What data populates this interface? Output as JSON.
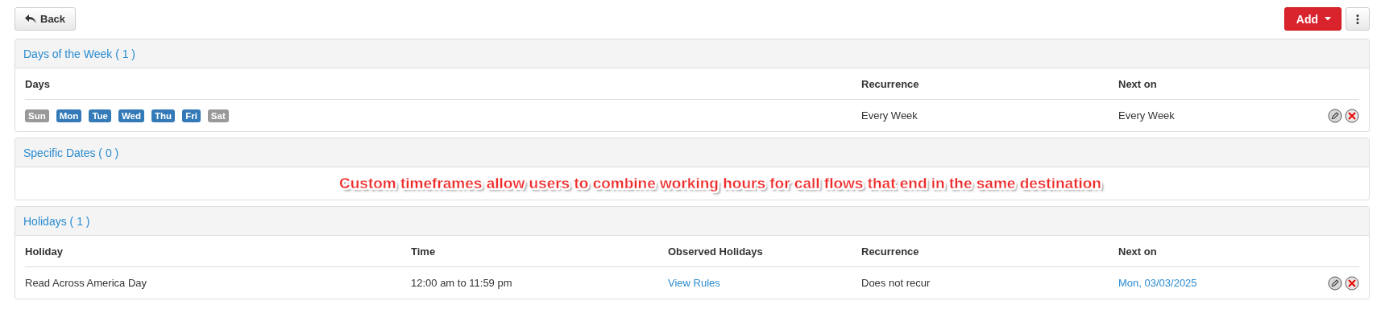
{
  "toolbar": {
    "back_button": "Back",
    "add_button": "Add"
  },
  "sections": [
    {
      "kind": "days",
      "title": "Days of the Week ( 1 )",
      "columns": [
        "Days",
        "Recurrence",
        "Next on"
      ],
      "rows": [
        {
          "cells": [
            {
              "kind": "days",
              "days": [
                {
                  "label": "Sun",
                  "selected": false
                },
                {
                  "label": "Mon",
                  "selected": true
                },
                {
                  "label": "Tue",
                  "selected": true
                },
                {
                  "label": "Wed",
                  "selected": true
                },
                {
                  "label": "Thu",
                  "selected": true
                },
                {
                  "label": "Fri",
                  "selected": true
                },
                {
                  "label": "Sat",
                  "selected": false
                }
              ]
            },
            {
              "kind": "text",
              "text": "Every Week"
            },
            {
              "kind": "text",
              "text": "Every Week"
            }
          ]
        }
      ]
    },
    {
      "kind": "dates",
      "title": "Specific Dates ( 0 )"
    },
    {
      "kind": "holidays",
      "title": "Holidays ( 1 )",
      "columns": [
        "Holiday",
        "Time",
        "Observed Holidays",
        "Recurrence",
        "Next on"
      ],
      "rows": [
        {
          "cells": [
            {
              "kind": "text",
              "text": "Read Across America Day"
            },
            {
              "kind": "text",
              "text": "12:00 am to 11:59 pm"
            },
            {
              "kind": "link",
              "text": "View Rules"
            },
            {
              "kind": "text",
              "text": "Does not recur"
            },
            {
              "kind": "link",
              "text": "Mon, 03/03/2025"
            }
          ]
        }
      ]
    }
  ],
  "annotation": "Custom timeframes allow users to combine working hours for call flows that end in the same destination"
}
